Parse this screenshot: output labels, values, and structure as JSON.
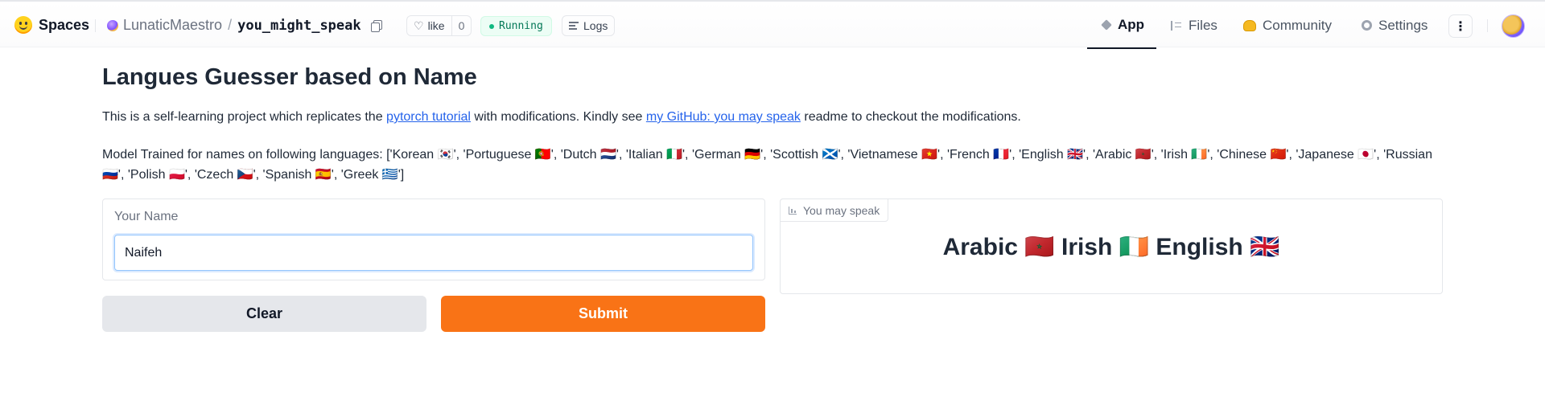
{
  "topbar": {
    "brand": "Spaces",
    "owner": "LunaticMaestro",
    "slash": "/",
    "repo": "you_might_speak",
    "like_label": "like",
    "like_count": "0",
    "status": "Running",
    "logs_label": "Logs",
    "nav": {
      "app": "App",
      "files": "Files",
      "community": "Community",
      "settings": "Settings"
    },
    "more": "⋮"
  },
  "page": {
    "title": "Langues Guesser based on Name",
    "desc_pre": "This is a self-learning project which replicates the ",
    "desc_link1": "pytorch tutorial",
    "desc_mid": " with modifications. Kindly see ",
    "desc_link2": "my GitHub: you may speak",
    "desc_post": " readme to checkout the modifications.",
    "languages_text": "Model Trained for names on following languages: ['Korean 🇰🇷', 'Portuguese 🇵🇹', 'Dutch 🇳🇱', 'Italian 🇮🇹', 'German 🇩🇪', 'Scottish 🏴󠁧󠁢󠁳󠁣󠁴󠁿', 'Vietnamese 🇻🇳', 'French 🇫🇷', 'English 🇬🇧', 'Arabic 🇲🇦', 'Irish 🇮🇪', 'Chinese 🇨🇳', 'Japanese 🇯🇵', 'Russian 🇷🇺', 'Polish 🇵🇱', 'Czech 🇨🇿', 'Spanish 🇪🇸', 'Greek 🇬🇷']"
  },
  "form": {
    "name_label": "Your Name",
    "name_value": "Naifeh",
    "clear_label": "Clear",
    "submit_label": "Submit"
  },
  "output": {
    "label": "You may speak",
    "result": "Arabic 🇲🇦 Irish 🇮🇪 English 🇬🇧"
  },
  "colors": {
    "accent": "#f97316",
    "link": "#2563eb",
    "running": "#10b981"
  }
}
